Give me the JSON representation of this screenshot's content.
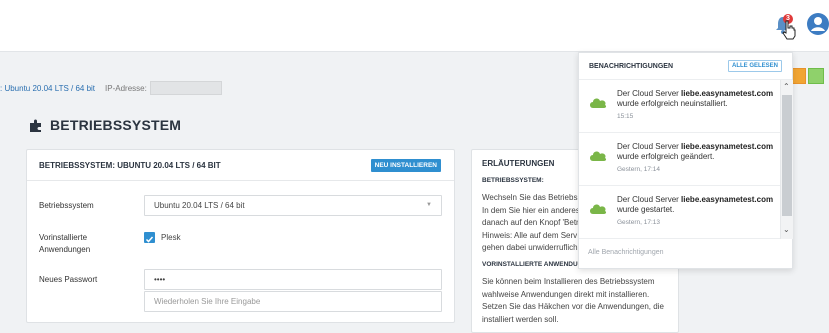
{
  "header": {
    "icons": [
      "bell-icon",
      "user-icon"
    ],
    "notification_count": "3"
  },
  "server_info": {
    "os_value": ": Ubuntu 20.04 LTS / 64 bit",
    "ip_label": "IP-Adresse:"
  },
  "page": {
    "title": "BETRIEBSSYSTEM"
  },
  "os_card": {
    "title": "BETRIEBSSYSTEM: UBUNTU 20.04 LTS / 64 BIT",
    "reinstall_label": "NEU INSTALLIEREN",
    "os_label": "Betriebssystem",
    "os_selected": "Ubuntu 20.04 LTS / 64 bit",
    "apps_label_line1": "Vorinstallierte",
    "apps_label_line2": "Anwendungen",
    "plesk_label": "Plesk",
    "password_label": "Neues Passwort",
    "password_value": "••••",
    "password_repeat_placeholder": "Wiederholen Sie Ihre Eingabe"
  },
  "explanation": {
    "title": "ERLÄUTERUNGEN",
    "section1": "BETRIEBSSYSTEM:",
    "text1": "Wechseln Sie das Betriebss... In dem Sie hier ein anderes... danach auf den Knopf 'Bet... Hinweis: Alle auf dem Serv... gehen dabei unwiderruflich...",
    "lines1": [
      "Wechseln Sie das Betriebss",
      "In dem Sie hier ein anderes",
      "danach auf den Knopf 'Betr",
      "Hinweis: Alle auf dem Serv",
      "gehen dabei unwiderruflich"
    ],
    "section2": "VORINSTALLIERTE ANWENDUN",
    "lines2": [
      "Sie können beim Installieren des Betriebssystem",
      "wahlweise Anwendungen direkt mit installieren.",
      "Setzen Sie das Häkchen vor die Anwendungen, die",
      "installiert werden soll."
    ]
  },
  "notifications": {
    "title": "BENACHRICHTIGUNGEN",
    "mark_all_read": "ALLE GELESEN",
    "footer": "Alle Benachrichtigungen",
    "items": [
      {
        "prefix": "Der Cloud Server ",
        "server": "liebe.easynametest.com",
        "message": "wurde erfolgreich neuinstalliert.",
        "time": "15:15"
      },
      {
        "prefix": "Der Cloud Server ",
        "server": "liebe.easynametest.com",
        "message": "wurde erfolgreich geändert.",
        "time": "Gestern, 17:14"
      },
      {
        "prefix": "Der Cloud Server ",
        "server": "liebe.easynametest.com",
        "message": "wurde gestartet.",
        "time": "Gestern, 17:13"
      }
    ]
  },
  "colors": {
    "accent": "#2f8fd0",
    "cloud_green": "#7ab648",
    "badge_red": "#e03a3a"
  }
}
